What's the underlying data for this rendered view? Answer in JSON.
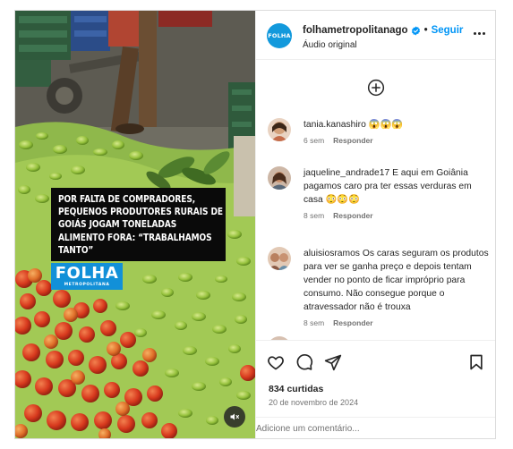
{
  "post": {
    "media": {
      "headline": "POR FALTA DE COMPRADORES, PEQUENOS PRODUTORES RURAIS DE GOIÁS JOGAM TONELADAS ALIMENTO FORA: “TRABALHAMOS TANTO”",
      "logo_main": "FOLHA",
      "logo_sub": "METROPOLITANA",
      "mute_icon": "speaker-muted-icon"
    },
    "header": {
      "avatar_text": "FOLHA",
      "username": "folhametropolitanago",
      "separator": "•",
      "follow_label": "Seguir",
      "audio": "Áudio original",
      "verified_color": "#0095f6"
    },
    "comments": [
      {
        "username": "tania.kanashiro",
        "text": "😱😱😱",
        "time": "6 sem",
        "reply": "Responder"
      },
      {
        "username": "jaqueline_andrade17",
        "text": "E aqui em Goiânia pagamos caro pra ter essas verduras em casa 😳😳😳",
        "time": "8 sem",
        "reply": "Responder"
      },
      {
        "username": "aluisiosramos",
        "text": "Os caras seguram os produtos para ver se ganha preço e depois tentam vender no ponto de ficar impróprio para consumo. Não consegue porque o atravessador não é trouxa",
        "time": "8 sem",
        "reply": "Responder"
      }
    ],
    "actions": {
      "likes_count": "834",
      "likes_label": "curtidas",
      "date": "20 de novembro de 2024"
    },
    "add_comment": {
      "placeholder": "Adicione um comentário..."
    },
    "colors": {
      "accent": "#0095f6",
      "border": "#dbdbdb",
      "muted_text": "#737373"
    }
  }
}
